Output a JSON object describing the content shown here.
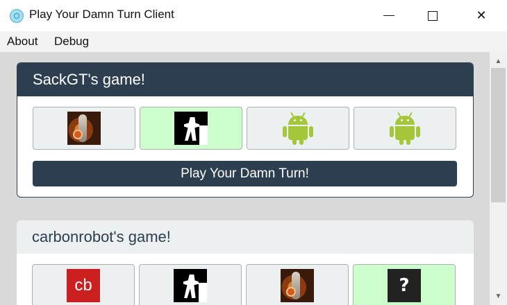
{
  "window": {
    "title": "Play Your Damn Turn Client",
    "controls": [
      "minimize",
      "maximize",
      "close"
    ]
  },
  "menu": {
    "items": [
      "About",
      "Debug"
    ]
  },
  "games": [
    {
      "title": "SackGT's game!",
      "header_bg": "#2c3e50",
      "players": [
        {
          "avatar": "portal-avatar",
          "active": false
        },
        {
          "avatar": "soldier-silhouette-avatar",
          "active": true
        },
        {
          "avatar": "android-avatar",
          "active": false
        },
        {
          "avatar": "android-avatar",
          "active": false
        }
      ],
      "play_button": "Play Your Damn Turn!"
    },
    {
      "title": "carbonrobot's game!",
      "header_bg": "#ecf0f1",
      "players": [
        {
          "avatar": "cb-avatar",
          "text": "cb",
          "active": false
        },
        {
          "avatar": "soldier-silhouette-avatar",
          "active": false
        },
        {
          "avatar": "portal-avatar",
          "active": false
        },
        {
          "avatar": "unknown-avatar",
          "text": "?",
          "active": true
        }
      ]
    }
  ],
  "colors": {
    "accent": "#2c3e50",
    "active_player": "#ccffcc",
    "inactive_player": "#ecf0f1",
    "android_green": "#a4c639"
  }
}
